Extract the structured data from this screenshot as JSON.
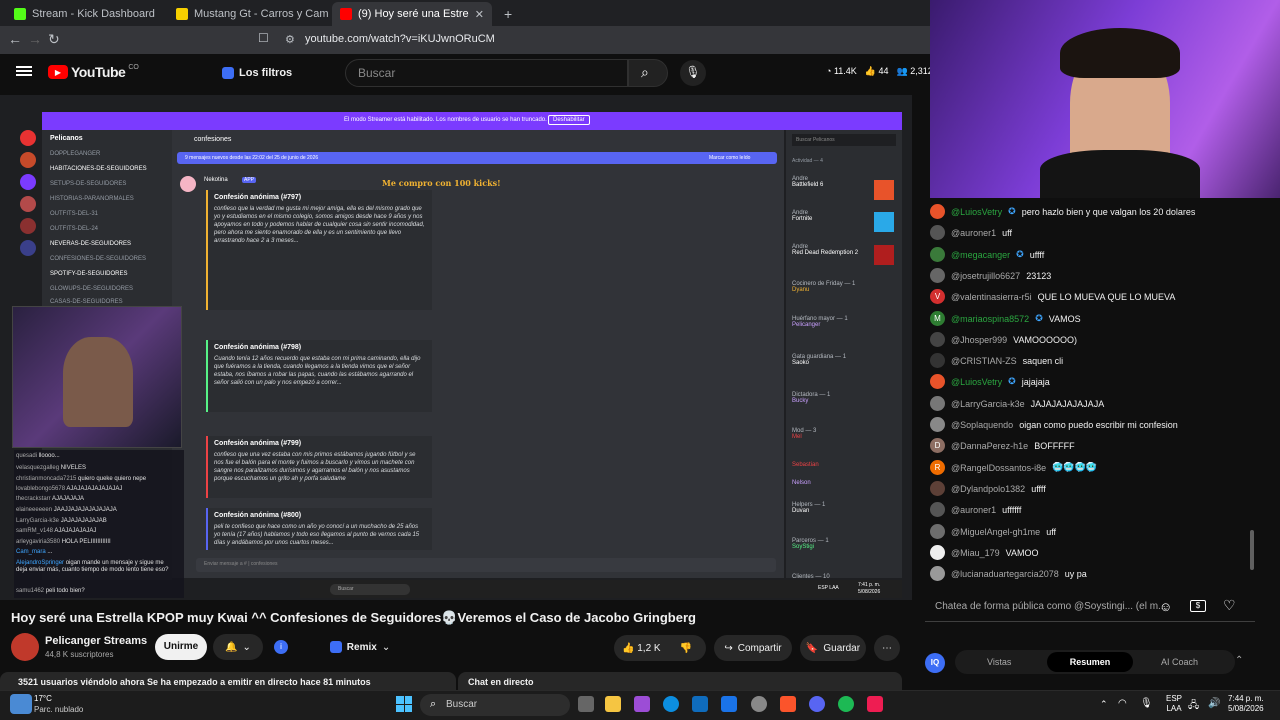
{
  "browser": {
    "tabs": [
      {
        "label": "Stream - Kick Dashboard",
        "icon": "kick-icon",
        "color": "#53fc18"
      },
      {
        "label": "Mustang Gt - Carros y Camionetas F",
        "icon": "marketplace-icon",
        "color": "#f7d000"
      },
      {
        "label": "(9) Hoy seré una Estrella KPOP",
        "icon": "youtube-icon",
        "color": "#ff0000"
      }
    ],
    "new_tab": "+",
    "url": "youtube.com/watch?v=iKUJwnORuCM"
  },
  "youtube": {
    "logo": "YouTube",
    "country": "CO",
    "filters": "Los filtros",
    "search_placeholder": "Buscar",
    "stats": {
      "views": "11.4K",
      "likes": "44",
      "viewers": "2,312"
    }
  },
  "discord": {
    "banner": "El modo Streamer está habilitado. Los nombres de usuario se han truncado.",
    "banner_button": "Deshabilitar",
    "server": "Pelicanos",
    "channel": "confesiones",
    "new_msgs": "9 mensajes nuevos desde las 22:02 del 25 de junio de 2026",
    "mark_read": "Marcar como leído",
    "search": "Buscar Pelicanos",
    "alert": "Me compro con 100 kicks!",
    "author": "Nekotina",
    "app_tag": "APP",
    "channels": [
      "DOPPLEGANGER",
      "HABITACIONES-DE-SEGUIDORES",
      "SETUPS-DE-SEGUIDORES",
      "HISTORIAS-PARANORMALES",
      "OUTFITS-DEL-31",
      "OUTFITS-DEL-24",
      "NEVERAS-DE-SEGUIDORES",
      "CONFESIONES-DE-SEGUIDORES",
      "SPOTIFY-DE-SEGUIDORES",
      "GLOWUPS-DE-SEGUIDORES",
      "CASAS-DE-SEGUIDORES"
    ],
    "messages": [
      {
        "title": "Confesión anónima (#797)",
        "body": "confieso que la verdad me gusta mi mejor amiga, ella es del mismo grado que yo y estudiamos en el mismo colegio, somos amigos desde hace 9 años y nos apoyamos en todo y podemos hablar de cualquier cosa sin sentir incomodidad, pero ahora me siento enamorado de ella y es un sentimiento que llevo arrastrando hace 2 a 3 meses..."
      },
      {
        "title": "Confesión anónima (#798)",
        "body": "Cuando tenía 12 años recuerdo que estaba con mi prima caminando, ella dijo que fuéramos a la tienda, cuando llegamos a la tienda vimos que el señor estaba, nos íbamos a robar las papas, cuando las estábamos agarrando el señor salió con un palo y nos empezó a correr..."
      },
      {
        "title": "Confesión anónima (#799)",
        "body": "confieso que una vez estaba con mis primos estábamos jugando fútbol y se nos fue el balón para el monte y fuimos a buscarlo y vimos un machete con sangre nos paralizamos durísimos y agarramos el balón y nos asustamos porque escuchamos un grito ah y porfa saludame"
      },
      {
        "title": "Confesión anónima (#800)",
        "body": "peli te confieso que hace como un año yo conocí a un muchacho de 25 años yo tenía (17 años) hablamos y todo eso llegamos al punto de vernos cada 15 días y andábamos por unos cuartos meses..."
      }
    ],
    "footer_from": "Pelicanos",
    "input_placeholder": "Enviar mensaje a # | confesiones",
    "activity_header": "Actividad — 4",
    "activity": [
      {
        "name": "Andre",
        "game": "Battlefield 6",
        "color": "#e8532a"
      },
      {
        "name": "Andre",
        "game": "Fortnite",
        "color": "#2aa9e8"
      },
      {
        "name": "Andre",
        "game": "Red Dead Redemption 2",
        "color": "#b01e1e"
      }
    ],
    "members": [
      {
        "role": "Cocinero de Friday — 1",
        "name": "Dyanu",
        "status": "PELI"
      },
      {
        "role": "Huérfano mayor — 1",
        "name": "Pelicanger",
        "status": "Alan Weber"
      },
      {
        "role": "Gata guardiana — 1",
        "name": "Saoko",
        "status": "Jugando con la mente"
      },
      {
        "role": "Dictadora — 1",
        "name": "Bucky",
        "status": ""
      },
      {
        "role": "Mod — 3",
        "name": "Mel",
        "status": "PELI"
      },
      {
        "role": "",
        "name": "Sebastian",
        "status": "PELI"
      },
      {
        "role": "",
        "name": "Nelson",
        "status": ""
      },
      {
        "role": "Helpers — 1",
        "name": "Duvan",
        "status": ""
      },
      {
        "role": "Parceros — 1",
        "name": "SoyStigi",
        "status": "Aisuo, Feel, WWDW"
      },
      {
        "role": "Clientes — 10",
        "name": "",
        "status": ""
      }
    ],
    "taskbar_search": "Buscar",
    "clock_time": "7:41 p. m.",
    "clock_date": "5/08/2026",
    "lang": "ESP LAA"
  },
  "stream_chat_overlay": [
    {
      "user": "quesadi",
      "msg": "lloooo..."
    },
    {
      "user": "velasquezgalleg",
      "msg": "NIVELES"
    },
    {
      "user": "christianmoncada7215",
      "msg": "quiero queke quiero nepe"
    },
    {
      "user": "lovablebongo5678",
      "msg": "AJAJAJAJAJAJAJAJ"
    },
    {
      "user": "thecrackstarr",
      "msg": "AJAJAJAJA"
    },
    {
      "user": "elaineeeeeen",
      "msg": "JAAJJAJAJAJAJAJAJA"
    },
    {
      "user": "LarryGarcia-k3e",
      "msg": "JAJAJAJAJAJAB"
    },
    {
      "user": "samRM_v148",
      "msg": "AJAJAJAJAJAJ"
    },
    {
      "user": "arleygaviria3580",
      "msg": "HOLA PELIIIIIIIIIIII"
    },
    {
      "user": "Cam_mara",
      "msg": "..."
    },
    {
      "user": "AlejandroSpringer",
      "msg": "oigan mande un mensaje y sigue me deja enviar más, cuanto tiempo de modo lento tiene eso?"
    },
    {
      "user": "samu1462",
      "msg": "peli todo bien?"
    }
  ],
  "live_chat": [
    {
      "user": "@LuiosVetry",
      "msg": "pero hazlo bien y que valgan los 20 dolares",
      "member": true,
      "verified": true,
      "av": "#e8532a"
    },
    {
      "user": "@auroner1",
      "msg": "uff",
      "member": false,
      "av": "#555"
    },
    {
      "user": "@megacanger",
      "msg": "uffff",
      "member": true,
      "verified": true,
      "av": "#3a7a3a"
    },
    {
      "user": "@josetrujillo6627",
      "msg": "23123",
      "member": false,
      "av": "#666"
    },
    {
      "user": "@valentinasierra-r5i",
      "msg": "QUE LO MUEVA QUE LO MUEVA",
      "member": false,
      "av": "#d32f2f",
      "initial": "V"
    },
    {
      "user": "@mariaospina8572",
      "msg": "VAMOS",
      "member": true,
      "verified": true,
      "av": "#2e7d32",
      "initial": "M"
    },
    {
      "user": "@Jhosper999",
      "msg": "VAMOOOOOO)",
      "member": false,
      "av": "#444"
    },
    {
      "user": "@CRISTIAN-ZS",
      "msg": "saquen cli",
      "member": false,
      "av": "#333"
    },
    {
      "user": "@LuiosVetry",
      "msg": "jajajaja",
      "member": true,
      "verified": true,
      "av": "#e8532a"
    },
    {
      "user": "@LarryGarcia-k3e",
      "msg": "JAJAJAJAJAJAJA",
      "member": false,
      "av": "#777"
    },
    {
      "user": "@Soplaquendo",
      "msg": "oigan como puedo escribir mi confesion",
      "member": false,
      "av": "#888"
    },
    {
      "user": "@DannaPerez-h1e",
      "msg": "BOFFFFF",
      "member": false,
      "av": "#8d6e63",
      "initial": "D"
    },
    {
      "user": "@RangelDossantos-i8e",
      "msg": "🥶🥶🥶🥶",
      "member": false,
      "av": "#ef6c00",
      "initial": "R"
    },
    {
      "user": "@Dylandpolo1382",
      "msg": "uffff",
      "member": false,
      "av": "#5d4037"
    },
    {
      "user": "@auroner1",
      "msg": "uffffff",
      "member": false,
      "av": "#555"
    },
    {
      "user": "@MiguelAngel-gh1me",
      "msg": "uff",
      "member": false,
      "av": "#6d6d6d"
    },
    {
      "user": "@Miau_179",
      "msg": "VAMOO",
      "member": false,
      "av": "#eee"
    },
    {
      "user": "@lucianaduartegarcia2078",
      "msg": "uy pa",
      "member": false,
      "av": "#999"
    }
  ],
  "chat_input_placeholder": "Chatea de forma pública como @Soystingi... (el m...",
  "video": {
    "title": "Hoy seré una Estrella KPOP muy Kwai ^^ Confesiones de Seguidores💀Veremos el Caso de Jacobo Gringberg",
    "channel": "Pelicanger Streams",
    "subscribers": "44,8 K suscriptores",
    "join": "Unirme",
    "remix": "Remix",
    "likes": "1,2 K",
    "share": "Compartir",
    "save": "Guardar",
    "live_info": "3521 usuarios viéndolo ahora  Se ha empezado a emitir en directo hace 81 minutos",
    "live_chat_label": "Chat en directo"
  },
  "iq_tabs": [
    "Vistas",
    "Resumen",
    "AI Coach"
  ],
  "windows": {
    "weather_temp": "17°C",
    "weather_desc": "Parc. nublado",
    "search": "Buscar",
    "lang_top": "ESP",
    "lang_bottom": "LAA",
    "time": "7:44 p. m.",
    "date": "5/08/2026"
  },
  "colors": {
    "youtube_red": "#ff0000",
    "discord_purple": "#7b3bff",
    "member_green": "#2ba640",
    "verified_blue": "#3ea6ff",
    "iq_blue": "#3d6ef5"
  }
}
